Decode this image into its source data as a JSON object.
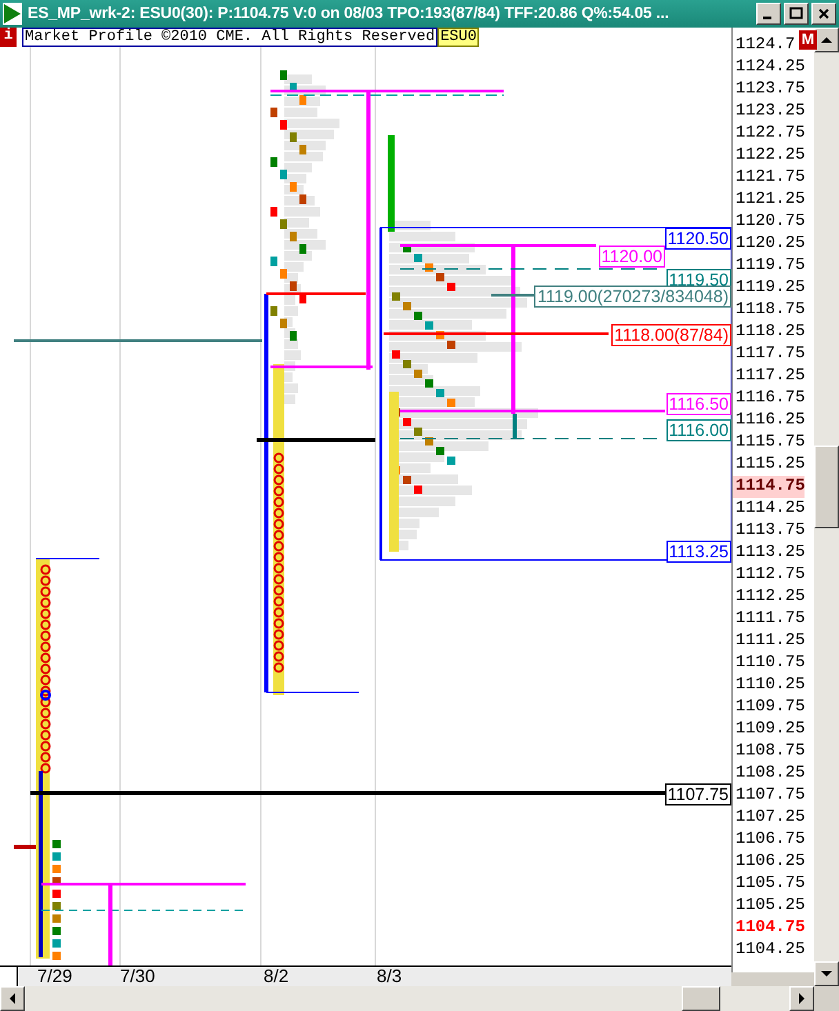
{
  "window": {
    "title": "ES_MP_wrk-2: ESU0(30): P:1104.75 V:0 on 08/03 TPO:193(87/84)  TFF:20.86 Q%:54.05 ..."
  },
  "header": {
    "info_icon": "i",
    "copyright": "Market Profile ©2010 CME. All Rights Reserved",
    "symbol": "ESU0",
    "marker": "M"
  },
  "price_labels": [
    {
      "text": "1120.50",
      "color": "#0000ff"
    },
    {
      "text": "1120.00",
      "color": "#ff00ff"
    },
    {
      "text": "1119.50",
      "color": "#008080"
    },
    {
      "text": "1119.00(270273/834048)",
      "color": "#408080"
    },
    {
      "text": "1118.00(87/84)",
      "color": "#ff0000"
    },
    {
      "text": "1116.50",
      "color": "#ff00ff"
    },
    {
      "text": "1116.00",
      "color": "#008080"
    },
    {
      "text": "1113.25",
      "color": "#0000ff"
    },
    {
      "text": "1107.75",
      "color": "#000000"
    }
  ],
  "price_axis": [
    {
      "text": "1124.7",
      "kind": "plain"
    },
    {
      "text": "1124.25",
      "kind": "plain"
    },
    {
      "text": "1123.75",
      "kind": "plain"
    },
    {
      "text": "1123.25",
      "kind": "plain"
    },
    {
      "text": "1122.75",
      "kind": "plain"
    },
    {
      "text": "1122.25",
      "kind": "plain"
    },
    {
      "text": "1121.75",
      "kind": "plain"
    },
    {
      "text": "1121.25",
      "kind": "plain"
    },
    {
      "text": "1120.75",
      "kind": "plain"
    },
    {
      "text": "1120.25",
      "kind": "plain"
    },
    {
      "text": "1119.75",
      "kind": "plain"
    },
    {
      "text": "1119.25",
      "kind": "plain"
    },
    {
      "text": "1118.75",
      "kind": "plain"
    },
    {
      "text": "1118.25",
      "kind": "plain"
    },
    {
      "text": "1117.75",
      "kind": "plain"
    },
    {
      "text": "1117.25",
      "kind": "plain"
    },
    {
      "text": "1116.75",
      "kind": "plain"
    },
    {
      "text": "1116.25",
      "kind": "plain"
    },
    {
      "text": "1115.75",
      "kind": "plain"
    },
    {
      "text": "1115.25",
      "kind": "plain"
    },
    {
      "text": "1114.75",
      "kind": "cursor"
    },
    {
      "text": "1114.25",
      "kind": "plain"
    },
    {
      "text": "1113.75",
      "kind": "plain"
    },
    {
      "text": "1113.25",
      "kind": "plain"
    },
    {
      "text": "1112.75",
      "kind": "plain"
    },
    {
      "text": "1112.25",
      "kind": "plain"
    },
    {
      "text": "1111.75",
      "kind": "plain"
    },
    {
      "text": "1111.25",
      "kind": "plain"
    },
    {
      "text": "1110.75",
      "kind": "plain"
    },
    {
      "text": "1110.25",
      "kind": "plain"
    },
    {
      "text": "1109.75",
      "kind": "plain"
    },
    {
      "text": "1109.25",
      "kind": "plain"
    },
    {
      "text": "1108.75",
      "kind": "plain"
    },
    {
      "text": "1108.25",
      "kind": "plain"
    },
    {
      "text": "1107.75",
      "kind": "plain"
    },
    {
      "text": "1107.25",
      "kind": "plain"
    },
    {
      "text": "1106.75",
      "kind": "plain"
    },
    {
      "text": "1106.25",
      "kind": "plain"
    },
    {
      "text": "1105.75",
      "kind": "plain"
    },
    {
      "text": "1105.25",
      "kind": "plain"
    },
    {
      "text": "1104.75",
      "kind": "last"
    },
    {
      "text": "1104.25",
      "kind": "plain"
    }
  ],
  "dates": [
    "7/29",
    "7/30",
    "8/2",
    "8/3"
  ]
}
